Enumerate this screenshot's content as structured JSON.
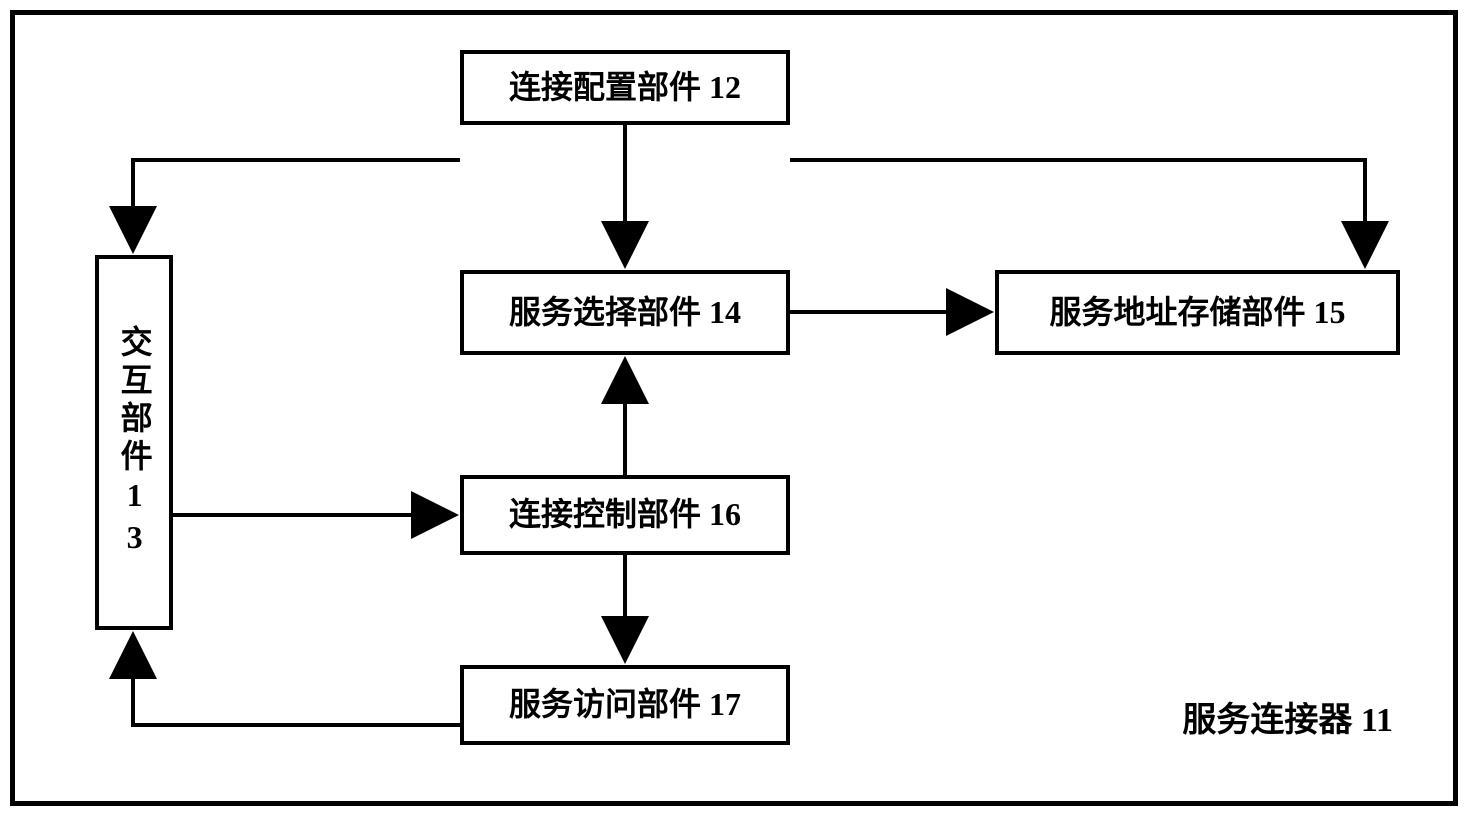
{
  "diagram": {
    "title": "服务连接器 11",
    "nodes": {
      "n12": "连接配置部件 12",
      "n13": "交互部件13",
      "n14": "服务选择部件 14",
      "n15": "服务地址存储部件 15",
      "n16": "连接控制部件 16",
      "n17": "服务访问部件 17"
    },
    "edges": [
      {
        "from": "n12",
        "to": "n13"
      },
      {
        "from": "n12",
        "to": "n14"
      },
      {
        "from": "n12",
        "to": "n15"
      },
      {
        "from": "n14",
        "to": "n15"
      },
      {
        "from": "n13",
        "to": "n16"
      },
      {
        "from": "n16",
        "to": "n14"
      },
      {
        "from": "n16",
        "to": "n17"
      },
      {
        "from": "n17",
        "to": "n13"
      }
    ]
  }
}
